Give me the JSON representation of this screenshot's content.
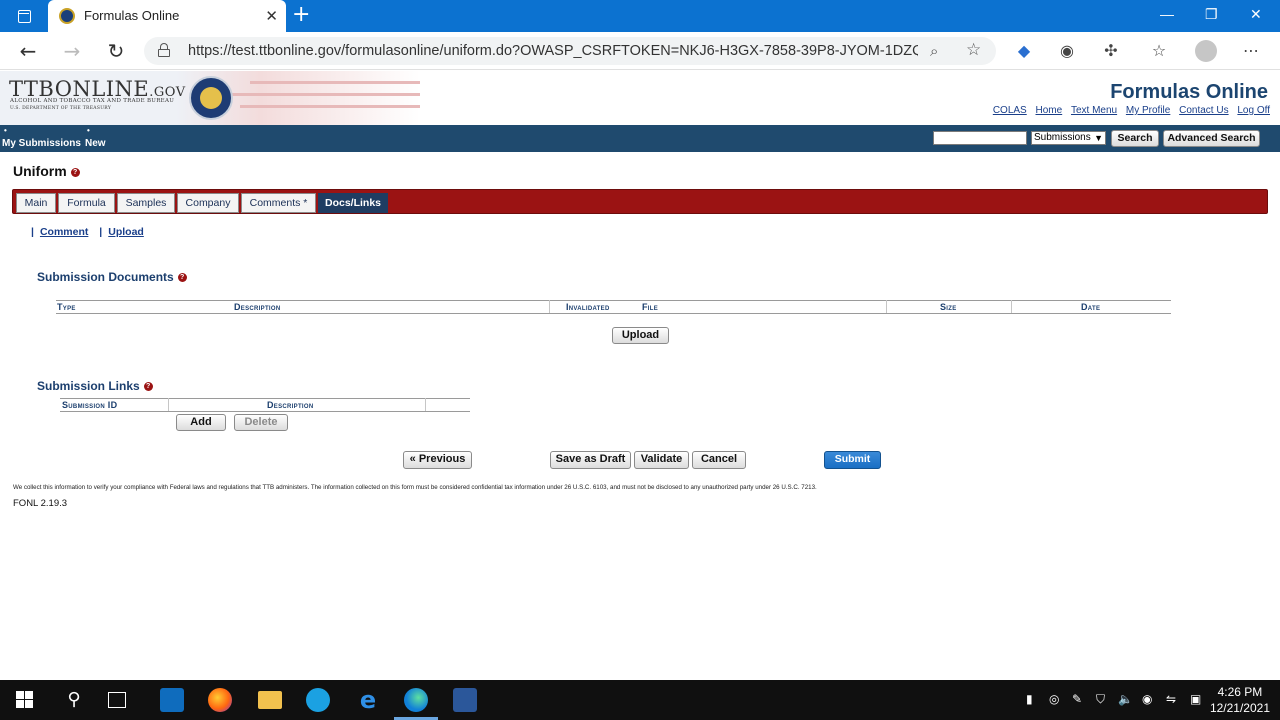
{
  "browser": {
    "tab_title": "Formulas Online",
    "url": "https://test.ttbonline.gov/formulasonline/uniform.do?OWASP_CSRFTOKEN=NKJ6-H3GX-7858-39P8-JYOM-1DZQ-DS..."
  },
  "header": {
    "logo_main": "TTBONLINE",
    "logo_gov": ".GOV",
    "logo_sub1": "ALCOHOL AND TOBACCO TAX AND TRADE BUREAU",
    "logo_sub2": "U.S. DEPARTMENT OF THE TREASURY",
    "site_title": "Formulas Online",
    "links": [
      "COLAS",
      "Home",
      "Text Menu",
      "My Profile",
      "Contact Us",
      "Log Off"
    ]
  },
  "nav": {
    "my_submissions": "My Submissions",
    "new": "New",
    "search_select_value": "Submissions",
    "search_button": "Search",
    "advanced_search_button": "Advanced Search"
  },
  "page": {
    "heading": "Uniform",
    "tabs": [
      "Main",
      "Formula",
      "Samples",
      "Company",
      "Comments *",
      "Docs/Links"
    ],
    "active_tab": "Docs/Links",
    "sublinks": [
      "Comment",
      "Upload"
    ]
  },
  "documents": {
    "title": "Submission Documents",
    "columns": [
      "Type",
      "Description",
      "Invalidated",
      "File",
      "Size",
      "Date"
    ],
    "upload_button": "Upload"
  },
  "links": {
    "title": "Submission Links",
    "columns": [
      "Submission ID",
      "Description"
    ],
    "add_button": "Add",
    "delete_button": "Delete"
  },
  "actions": {
    "previous": "« Previous",
    "save_draft": "Save as Draft",
    "validate": "Validate",
    "cancel": "Cancel",
    "submit": "Submit"
  },
  "footer": {
    "disclaimer": "We collect this information to verify your compliance with Federal laws and regulations that TTB administers. The information collected on this form must be considered confidential tax information under 26 U.S.C. 6103, and must not be disclosed to any unauthorized party under 26 U.S.C. 7213.",
    "version": "FONL 2.19.3"
  },
  "taskbar": {
    "time": "4:26 PM",
    "date": "12/21/2021"
  },
  "colors": {
    "brand_navy": "#1f4a6e",
    "tab_red": "#9b1313",
    "active_tab": "#1f3d62",
    "submit_blue": "#1a6fc4"
  }
}
